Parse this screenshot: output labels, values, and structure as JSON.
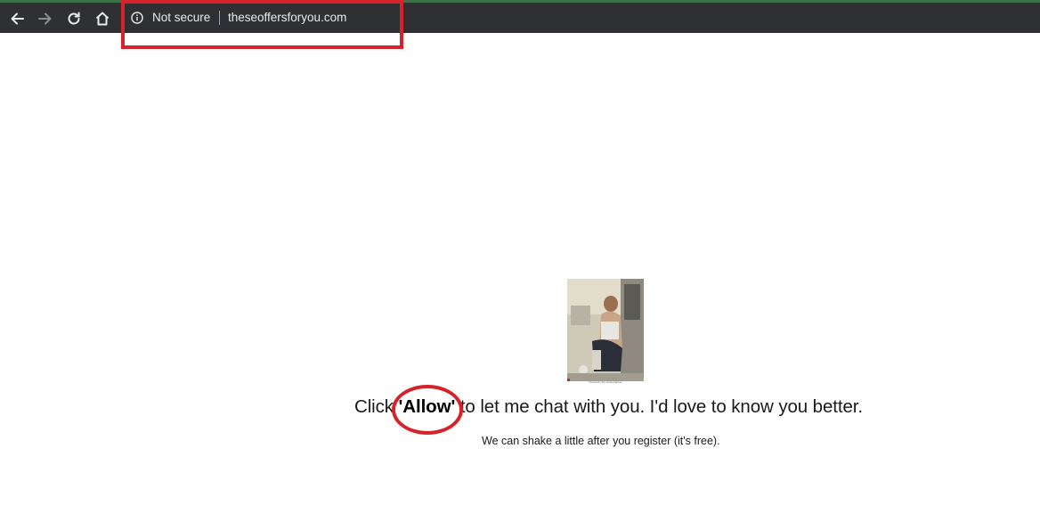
{
  "browser": {
    "security_label": "Not secure",
    "url": "theseoffersforyou.com",
    "icons": [
      "back-arrow-icon",
      "forward-arrow-icon",
      "reload-icon",
      "home-icon",
      "info-icon"
    ]
  },
  "annotations": {
    "highlight_color": "#d6232b"
  },
  "page": {
    "message_prefix": "Click ",
    "allow_word": "'Allow'",
    "message_suffix": " to let me chat with you. I'd love to know you better.",
    "sub_message": "We can shake a little after you register (it's free).",
    "photo_caption": "Posted by the photographer"
  }
}
